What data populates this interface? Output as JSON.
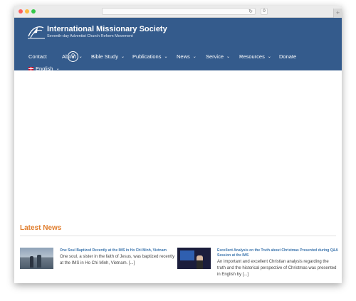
{
  "browser": {
    "address": "",
    "extension_label": "0",
    "new_tab_label": "+"
  },
  "site": {
    "name": "International Missionary Society",
    "tagline": "Seventh-day Adventist Church Reform Movement"
  },
  "nav": {
    "items": [
      {
        "label": "Contact",
        "dropdown": false
      },
      {
        "label": "About",
        "dropdown": true
      },
      {
        "label": "Bible Study",
        "dropdown": true
      },
      {
        "label": "Publications",
        "dropdown": true
      },
      {
        "label": "News",
        "dropdown": true
      },
      {
        "label": "Service",
        "dropdown": true
      },
      {
        "label": "Resources",
        "dropdown": true
      },
      {
        "label": "Donate",
        "dropdown": false
      }
    ],
    "language": {
      "label": "English",
      "dropdown": true
    }
  },
  "icons": {
    "chevron": "chevron-down-icon",
    "search": "search-icon",
    "reload": "reload-icon",
    "flag": "uk-flag-icon",
    "logo": "ims-logo-icon"
  },
  "colors": {
    "header_bg": "#345b8c",
    "accent": "#e07d2c",
    "link": "#3f77ae"
  },
  "news": {
    "heading": "Latest News",
    "articles": [
      {
        "title": "One Soul Baptized Recently at the IMS in Ho Chi Minh, Vietnam",
        "excerpt": "One soul, a sister in the faith of Jesus, was baptized recently at the IMS in Ho Chi Minh, Vietnam. [...]"
      },
      {
        "title": "Excellent Analysis on the Truth about Christmas Presented during Q&A Session at the IMS",
        "excerpt": "An important and excellent Christian analysis regarding the truth and the historical perspective of Christmas was presented in English by [...]"
      }
    ]
  }
}
